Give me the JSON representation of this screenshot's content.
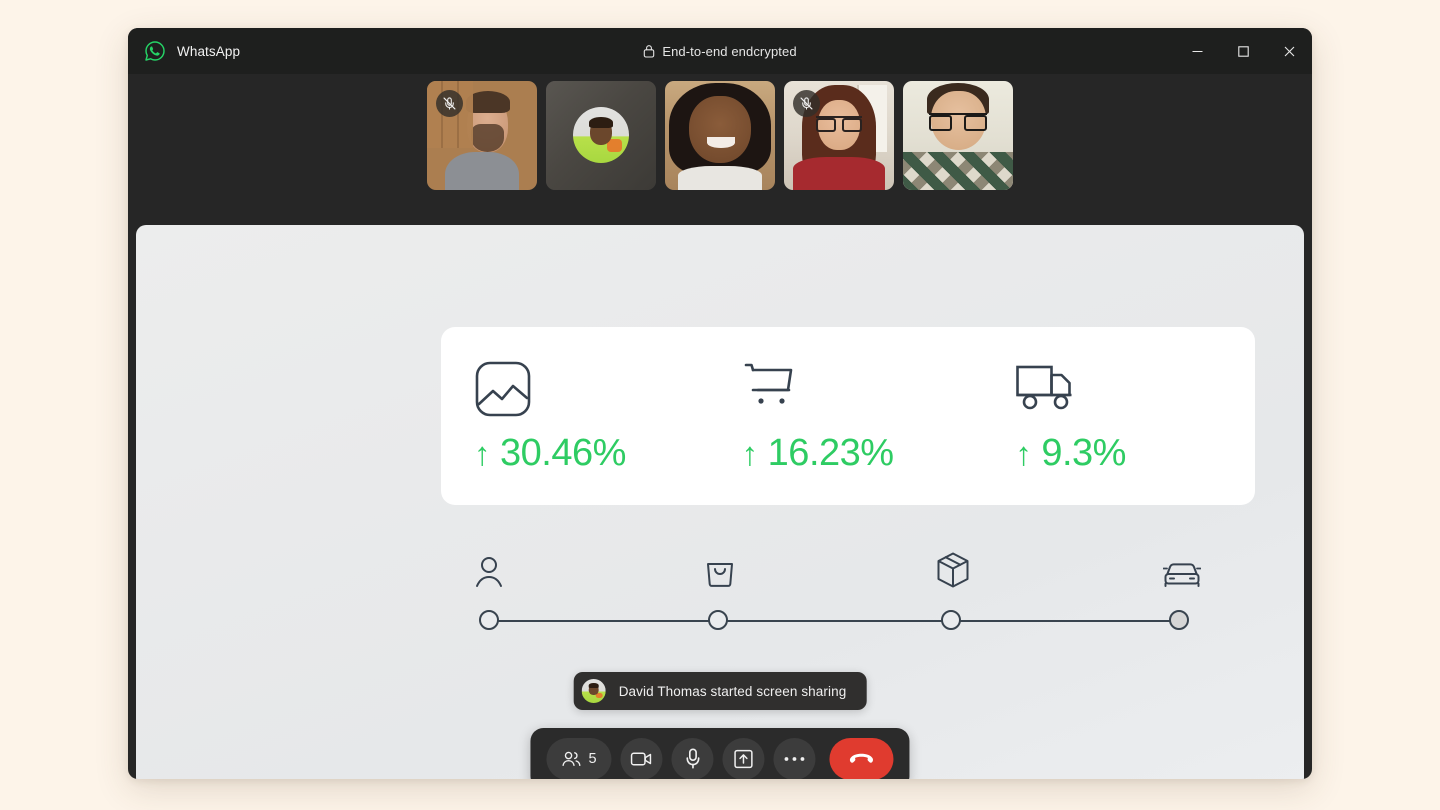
{
  "window": {
    "app_name": "WhatsApp",
    "app_logo_icon": "whatsapp-logo-icon",
    "encryption_label": "End-to-end endcrypted",
    "encryption_icon": "lock-icon",
    "controls": {
      "minimize": "minimize-icon",
      "maximize": "maximize-icon",
      "close": "close-icon"
    }
  },
  "filmstrip": {
    "tiles": [
      {
        "id": "participant-1",
        "camera_on": true,
        "muted": true,
        "mute_icon": "mic-off-icon"
      },
      {
        "id": "participant-2",
        "camera_on": false,
        "muted": false,
        "avatar": "avatar"
      },
      {
        "id": "participant-3",
        "camera_on": true,
        "muted": false
      },
      {
        "id": "participant-4",
        "camera_on": true,
        "muted": true,
        "mute_icon": "mic-off-icon"
      },
      {
        "id": "participant-5",
        "camera_on": true,
        "muted": false
      }
    ]
  },
  "shared_screen": {
    "metrics": [
      {
        "icon": "image-chart-icon",
        "arrow": "↑",
        "value": "30.46%"
      },
      {
        "icon": "shopping-cart-icon",
        "arrow": "↑",
        "value": "16.23%"
      },
      {
        "icon": "delivery-truck-icon",
        "arrow": "↑",
        "value": "9.3%"
      }
    ],
    "metric_color": "#2ecc63",
    "stepper": {
      "steps": [
        {
          "icon": "user-icon",
          "position_pct": 0,
          "filled": false
        },
        {
          "icon": "shopping-bag-icon",
          "position_pct": 33.3,
          "filled": false
        },
        {
          "icon": "package-box-icon",
          "position_pct": 66.6,
          "filled": false
        },
        {
          "icon": "car-icon",
          "position_pct": 100,
          "filled": true
        }
      ]
    }
  },
  "toast": {
    "avatar_icon": "avatar",
    "message": "David Thomas started screen sharing"
  },
  "controlbar": {
    "participants": {
      "icon": "people-icon",
      "count": "5"
    },
    "buttons": [
      {
        "name": "camera-button",
        "icon": "video-camera-icon"
      },
      {
        "name": "microphone-button",
        "icon": "microphone-icon"
      },
      {
        "name": "share-screen-button",
        "icon": "share-screen-icon"
      },
      {
        "name": "more-options-button",
        "icon": "ellipsis-icon"
      },
      {
        "name": "end-call-button",
        "icon": "phone-hangup-icon"
      }
    ],
    "end_call_color": "#e03b2f"
  }
}
